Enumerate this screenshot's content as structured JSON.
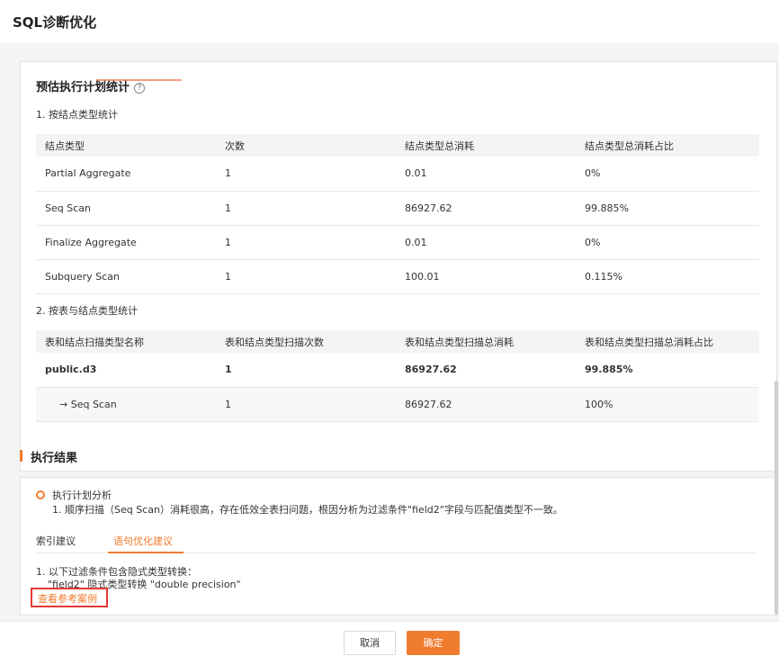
{
  "window": {
    "title": "SQL诊断优化"
  },
  "estimate": {
    "title": "预估执行计划统计",
    "help_icon": "?",
    "by_node": {
      "subtitle": "1. 按结点类型统计",
      "headers": [
        "结点类型",
        "次数",
        "结点类型总消耗",
        "结点类型总消耗占比"
      ],
      "rows": [
        [
          "Partial Aggregate",
          "1",
          "0.01",
          "0%"
        ],
        [
          "Seq Scan",
          "1",
          "86927.62",
          "99.885%"
        ],
        [
          "Finalize Aggregate",
          "1",
          "0.01",
          "0%"
        ],
        [
          "Subquery Scan",
          "1",
          "100.01",
          "0.115%"
        ]
      ]
    },
    "by_table": {
      "subtitle": "2. 按表与结点类型统计",
      "headers": [
        "表和结点扫描类型名称",
        "表和结点类型扫描次数",
        "表和结点类型扫描总消耗",
        "表和结点类型扫描总消耗占比"
      ],
      "rows": [
        [
          "public.d3",
          "1",
          "86927.62",
          "99.885%"
        ],
        [
          "→ Seq Scan",
          "1",
          "86927.62",
          "100%"
        ]
      ]
    }
  },
  "result": {
    "title": "执行结果",
    "analysis_title": "执行计划分析",
    "analysis_line": "1. 顺序扫描（Seq Scan）消耗很高，存在低效全表扫问题，根因分析为过滤条件\"field2\"字段与匹配值类型不一致。",
    "tabs": [
      "索引建议",
      "语句优化建议"
    ],
    "active_tab": 1,
    "suggestion_line1": "1. 以下过滤条件包含隐式类型转换：",
    "suggestion_line2": "\"field2\" 隐式类型转换 \"double precision\"",
    "ref_link": "查看参考案例"
  },
  "footer": {
    "cancel": "取消",
    "ok": "确定"
  },
  "colors": {
    "accent": "#f07c2e",
    "highlight_border": "#e53935"
  }
}
